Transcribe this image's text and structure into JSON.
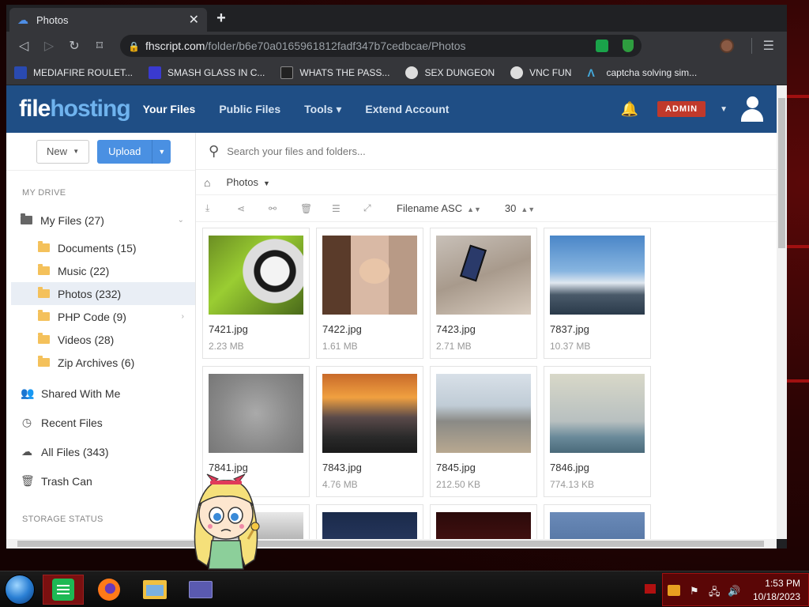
{
  "browser": {
    "tab_title": "Photos",
    "new_tab": "+",
    "close": "✕",
    "url_host": "fhscript.com",
    "url_path": "/folder/b6e70a0165961812fadf347b7cedbcae/Photos",
    "bookmarks": [
      {
        "label": "MEDIAFIRE ROULET...",
        "icon_color": "#2a4ab0"
      },
      {
        "label": "SMASH GLASS IN C...",
        "icon_color": "#3a3ad0"
      },
      {
        "label": "WHATS THE PASS...",
        "icon_color": "#222222"
      },
      {
        "label": "SEX DUNGEON",
        "icon_color": "#dddddd"
      },
      {
        "label": "VNC FUN",
        "icon_color": "#dddddd"
      },
      {
        "label": "captcha solving sim...",
        "icon_color": "#35363a"
      }
    ]
  },
  "site": {
    "logo_part1": "file",
    "logo_part2": "hosting",
    "nav": [
      "Your Files",
      "Public Files",
      "Tools",
      "Extend Account"
    ],
    "tools_caret": "▾",
    "admin_badge": "ADMIN",
    "accent": "#1f4e85"
  },
  "sidebar": {
    "new_label": "New",
    "upload_label": "Upload",
    "my_drive_title": "MY DRIVE",
    "my_files": "My Files (27)",
    "folders": [
      "Documents (15)",
      "Music (22)",
      "Photos (232)",
      "PHP Code (9)",
      "Videos (28)",
      "Zip Archives (6)"
    ],
    "shared": "Shared With Me",
    "recent": "Recent Files",
    "all_files": "All Files (343)",
    "trash": "Trash Can",
    "storage_title": "STORAGE STATUS"
  },
  "main": {
    "search_placeholder": "Search your files and folders...",
    "breadcrumb": "Photos",
    "sort": "Filename ASC",
    "per_page": "30",
    "files": [
      {
        "name": "7421.jpg",
        "size": "2.23 MB"
      },
      {
        "name": "7422.jpg",
        "size": "1.61 MB"
      },
      {
        "name": "7423.jpg",
        "size": "2.71 MB"
      },
      {
        "name": "7837.jpg",
        "size": "10.37 MB"
      },
      {
        "name": "7841.jpg",
        "size": ""
      },
      {
        "name": "7843.jpg",
        "size": "4.76 MB"
      },
      {
        "name": "7845.jpg",
        "size": "212.50 KB"
      },
      {
        "name": "7846.jpg",
        "size": "774.13 KB"
      }
    ]
  },
  "taskbar": {
    "time": "1:53 PM",
    "date": "10/18/2023"
  }
}
